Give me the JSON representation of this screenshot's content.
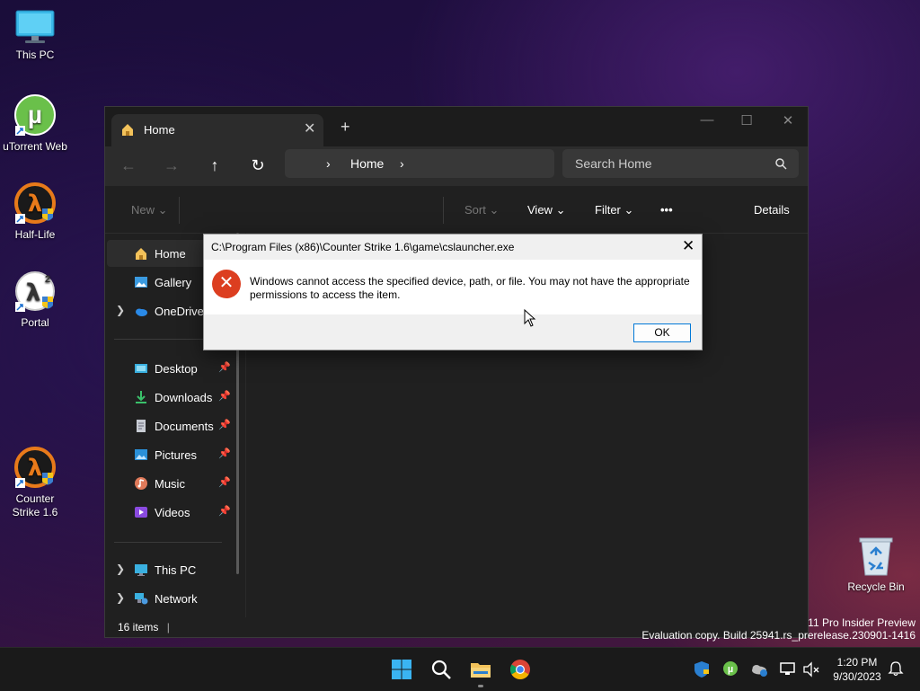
{
  "desktop": {
    "icons": [
      {
        "label": "This PC"
      },
      {
        "label": "uTorrent Web"
      },
      {
        "label": "Half-Life"
      },
      {
        "label": "Portal"
      },
      {
        "label": "Counter\nStrike 1.6"
      },
      {
        "label": "Recycle Bin"
      }
    ],
    "watermark_line1": "11 Pro Insider Preview",
    "watermark_line2": "Evaluation copy. Build 25941.rs_prerelease.230901-1416"
  },
  "explorer": {
    "tab_label": "Home",
    "tab_close": "✕",
    "new_tab": "+",
    "window_controls": {
      "minimize": "—",
      "maximize": "☐",
      "close": "✕"
    },
    "nav": {
      "back": "←",
      "forward": "→",
      "up": "↑",
      "refresh": "↻"
    },
    "breadcrumb": {
      "chevron": "›",
      "current": "Home"
    },
    "search_placeholder": "Search Home",
    "commands": {
      "new": "New",
      "sort": "Sort",
      "view": "View",
      "filter": "Filter",
      "more": "•••",
      "details": "Details"
    },
    "sidebar": {
      "items": [
        {
          "label": "Home",
          "pinned": false
        },
        {
          "label": "Gallery",
          "pinned": false
        },
        {
          "label": "OneDrive",
          "pinned": false
        },
        {
          "label": "Desktop",
          "pinned": true
        },
        {
          "label": "Downloads",
          "pinned": true
        },
        {
          "label": "Documents",
          "pinned": true
        },
        {
          "label": "Pictures",
          "pinned": true
        },
        {
          "label": "Music",
          "pinned": true
        },
        {
          "label": "Videos",
          "pinned": true
        },
        {
          "label": "This PC",
          "pinned": false
        },
        {
          "label": "Network",
          "pinned": false
        }
      ]
    },
    "status": "16 items"
  },
  "dialog": {
    "title": "C:\\Program Files (x86)\\Counter Strike 1.6\\game\\cslauncher.exe",
    "close": "✕",
    "message": "Windows cannot access the specified device, path, or file. You may not have the appropriate permissions to access the item.",
    "ok_label": "OK",
    "icon": "error-icon"
  },
  "taskbar": {
    "time": "1:20 PM",
    "date": "9/30/2023"
  },
  "colors": {
    "accent": "#0078d7",
    "error": "#dc3e20",
    "explorer_bg": "#202020"
  }
}
